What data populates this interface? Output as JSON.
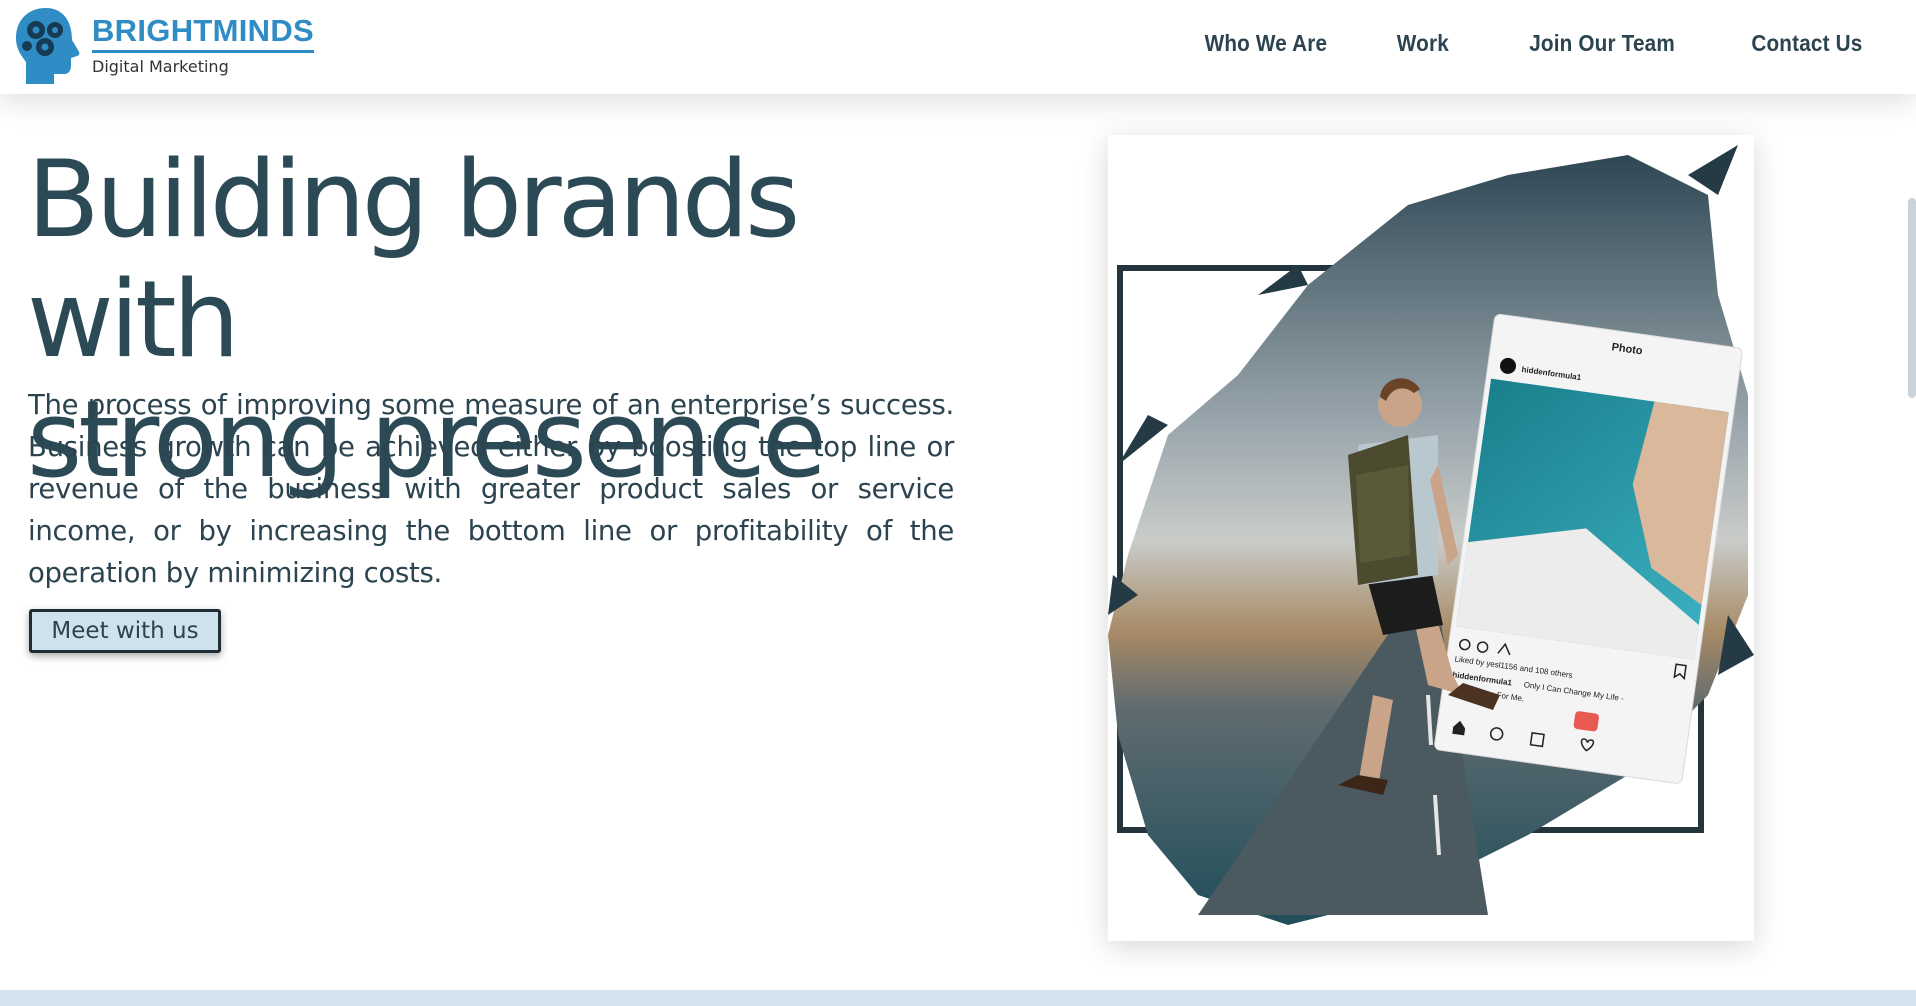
{
  "brand": {
    "name": "BRIGHTMINDS",
    "tagline": "Digital Marketing",
    "color": "#2f8cc4"
  },
  "nav": {
    "items": [
      {
        "label": "Who We Are"
      },
      {
        "label": "Work"
      },
      {
        "label": "Join Our Team"
      },
      {
        "label": "Contact Us"
      }
    ]
  },
  "hero": {
    "title_line1": "Building brands with",
    "title_line2": "strong presence",
    "body": "The process of improving some measure of an enterprise’s success. Business growth can be achieved either by boosting the top line or revenue of the business with greater product sales or service income, or by increasing the bottom line or profitability of the operation by minimizing costs.",
    "cta_label": "Meet with us"
  },
  "card": {
    "phone_header": "Photo",
    "username": "hiddenformula1",
    "liked_by": "Liked by yesl1156 and 108 others",
    "caption_user": "hiddenformula1",
    "caption_line1": "Only I Can Change My Life -",
    "caption_line2": "No One Can For Me."
  },
  "colors": {
    "heading": "#2c4a56",
    "text": "#2c4450",
    "cta_bg": "#cfe1ec",
    "footer_strip": "#d2e3ee"
  }
}
